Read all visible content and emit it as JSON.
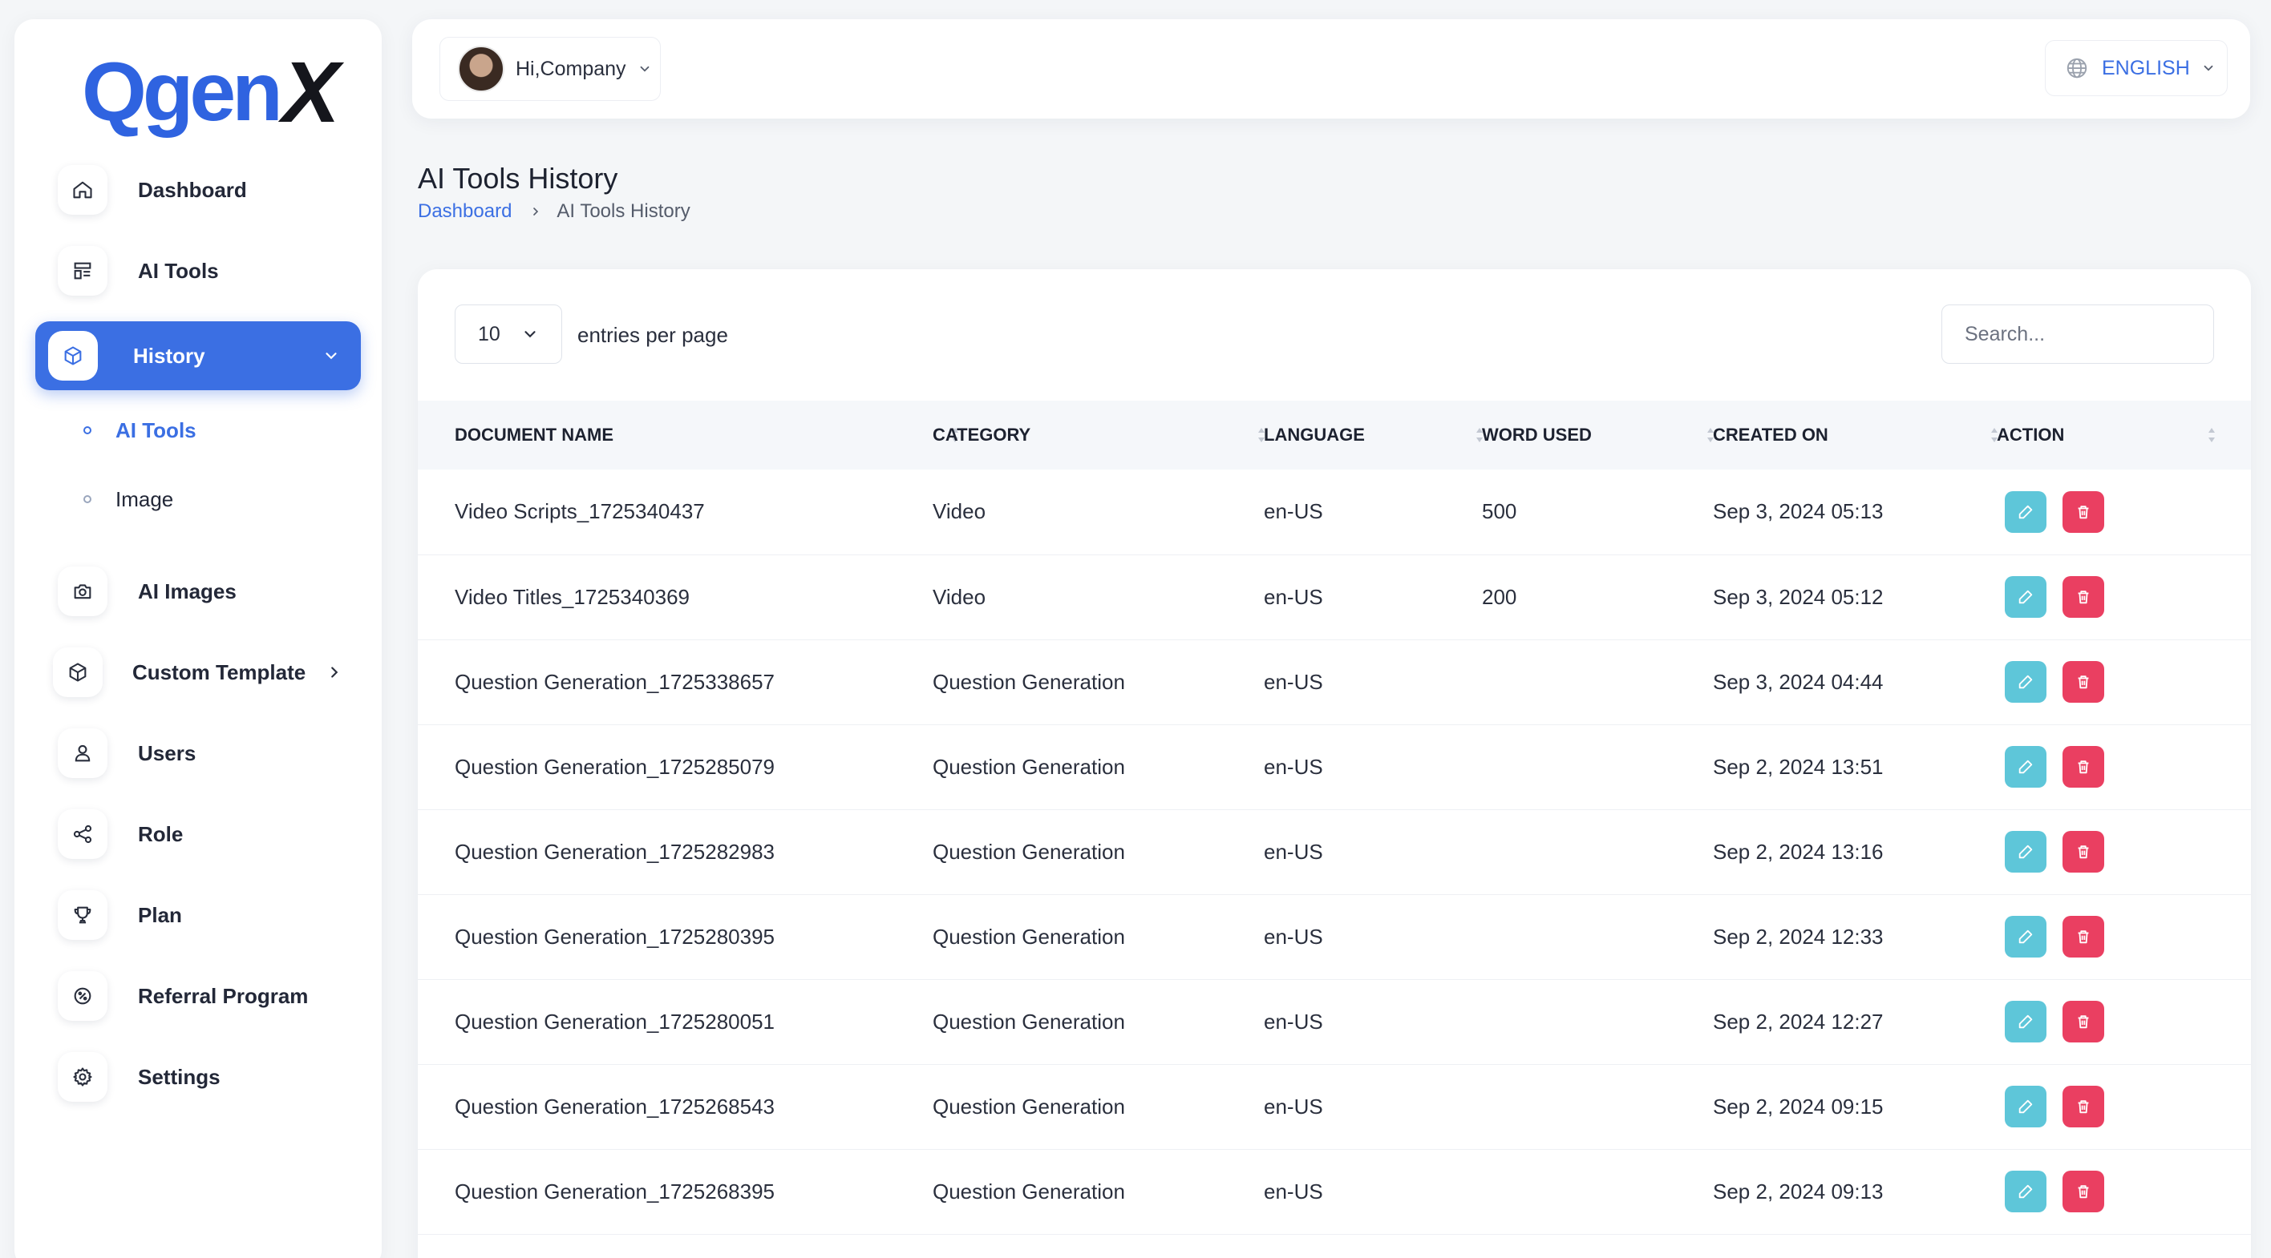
{
  "brand": {
    "logo_main": "Qgen",
    "logo_accent": "X"
  },
  "sidebar": {
    "items": [
      {
        "label": "Dashboard",
        "icon": "home-icon"
      },
      {
        "label": "AI Tools",
        "icon": "layout-icon"
      },
      {
        "label": "History",
        "icon": "cube-icon",
        "active": true,
        "expanded": true
      },
      {
        "label": "AI Images",
        "icon": "camera-icon"
      },
      {
        "label": "Custom Template",
        "icon": "cube-icon",
        "has_children": true
      },
      {
        "label": "Users",
        "icon": "user-icon"
      },
      {
        "label": "Role",
        "icon": "share-icon"
      },
      {
        "label": "Plan",
        "icon": "trophy-icon"
      },
      {
        "label": "Referral Program",
        "icon": "discount-icon"
      },
      {
        "label": "Settings",
        "icon": "gear-icon"
      }
    ],
    "history_children": [
      {
        "label": "AI Tools",
        "active": true
      },
      {
        "label": "Image",
        "active": false
      }
    ]
  },
  "topbar": {
    "greeting": "Hi,Company",
    "language": "ENGLISH"
  },
  "page": {
    "title": "AI Tools History",
    "breadcrumb": {
      "home": "Dashboard",
      "current": "AI Tools History"
    }
  },
  "table_controls": {
    "per_page_value": "10",
    "per_page_label": "entries per page",
    "search_placeholder": "Search..."
  },
  "table": {
    "columns": [
      "DOCUMENT NAME",
      "CATEGORY",
      "LANGUAGE",
      "WORD USED",
      "CREATED ON",
      "ACTION"
    ],
    "rows": [
      [
        "Video Scripts_1725340437",
        "Video",
        "en-US",
        "500",
        "Sep 3, 2024 05:13"
      ],
      [
        "Video Titles_1725340369",
        "Video",
        "en-US",
        "200",
        "Sep 3, 2024 05:12"
      ],
      [
        "Question Generation_1725338657",
        "Question Generation",
        "en-US",
        "",
        "Sep 3, 2024 04:44"
      ],
      [
        "Question Generation_1725285079",
        "Question Generation",
        "en-US",
        "",
        "Sep 2, 2024 13:51"
      ],
      [
        "Question Generation_1725282983",
        "Question Generation",
        "en-US",
        "",
        "Sep 2, 2024 13:16"
      ],
      [
        "Question Generation_1725280395",
        "Question Generation",
        "en-US",
        "",
        "Sep 2, 2024 12:33"
      ],
      [
        "Question Generation_1725280051",
        "Question Generation",
        "en-US",
        "",
        "Sep 2, 2024 12:27"
      ],
      [
        "Question Generation_1725268543",
        "Question Generation",
        "en-US",
        "",
        "Sep 2, 2024 09:15"
      ],
      [
        "Question Generation_1725268395",
        "Question Generation",
        "en-US",
        "",
        "Sep 2, 2024 09:13"
      ]
    ]
  },
  "colors": {
    "accent": "#3b6fe3",
    "edit_button": "#5ec6d9",
    "delete_button": "#ea3f61"
  }
}
